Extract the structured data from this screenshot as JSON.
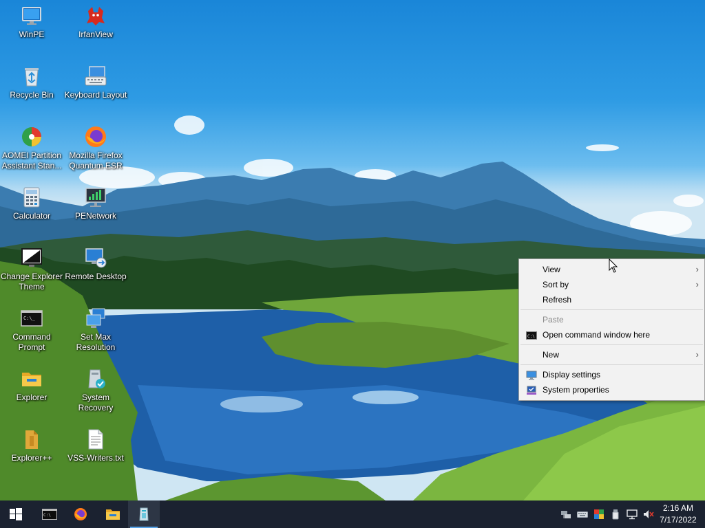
{
  "desktop": {
    "icons": [
      {
        "label": "WinPE",
        "icon": "monitor-icon"
      },
      {
        "label": "IrfanView",
        "icon": "irfanview-cat-icon"
      },
      {
        "label": "Recycle Bin",
        "icon": "recycle-bin-icon"
      },
      {
        "label": "Keyboard Layout",
        "icon": "keyboard-icon"
      },
      {
        "label": "AOMEI Partition Assistant Stan...",
        "icon": "aomei-partition-icon"
      },
      {
        "label": "Mozilla Firefox Quantum ESR",
        "icon": "firefox-icon"
      },
      {
        "label": "Calculator",
        "icon": "calculator-icon"
      },
      {
        "label": "PENetwork",
        "icon": "network-monitor-icon"
      },
      {
        "label": "Change Explorer Theme",
        "icon": "theme-icon"
      },
      {
        "label": "Remote Desktop",
        "icon": "remote-desktop-icon"
      },
      {
        "label": "Command Prompt",
        "icon": "cmd-icon"
      },
      {
        "label": "Set Max Resolution",
        "icon": "resolution-icon"
      },
      {
        "label": "Explorer",
        "icon": "folder-icon"
      },
      {
        "label": "System Recovery",
        "icon": "system-recovery-icon"
      },
      {
        "label": "Explorer++",
        "icon": "explorerplusplus-icon"
      },
      {
        "label": "VSS-Writers.txt",
        "icon": "text-file-icon"
      }
    ]
  },
  "context_menu": {
    "items": [
      {
        "label": "View",
        "has_submenu": true
      },
      {
        "label": "Sort by",
        "has_submenu": true
      },
      {
        "label": "Refresh"
      },
      {
        "label": "Paste",
        "disabled": true
      },
      {
        "label": "Open command window here",
        "icon": "cmd-icon"
      },
      {
        "label": "New",
        "has_submenu": true
      },
      {
        "label": "Display settings",
        "icon": "display-icon"
      },
      {
        "label": "System properties",
        "icon": "system-properties-icon"
      }
    ],
    "submenu_arrow": "›"
  },
  "taskbar": {
    "apps": [
      {
        "name": "start-button",
        "icon": "windows-logo-icon"
      },
      {
        "name": "cmd",
        "icon": "cmd-icon"
      },
      {
        "name": "firefox",
        "icon": "firefox-icon"
      },
      {
        "name": "explorer",
        "icon": "folder-icon"
      },
      {
        "name": "system-recovery",
        "icon": "system-recovery-icon",
        "active": true
      }
    ],
    "tray_icons": [
      "network-adapter-icon",
      "keyboard-icon",
      "color-icon",
      "usb-drive-icon",
      "network-icon",
      "volume-muted-icon"
    ],
    "clock": {
      "time": "2:16 AM",
      "date": "7/17/2022"
    }
  },
  "colors": {
    "taskbar_bg": "#1b2230",
    "menu_bg": "#f2f2f2",
    "accent": "#58a4e8"
  }
}
